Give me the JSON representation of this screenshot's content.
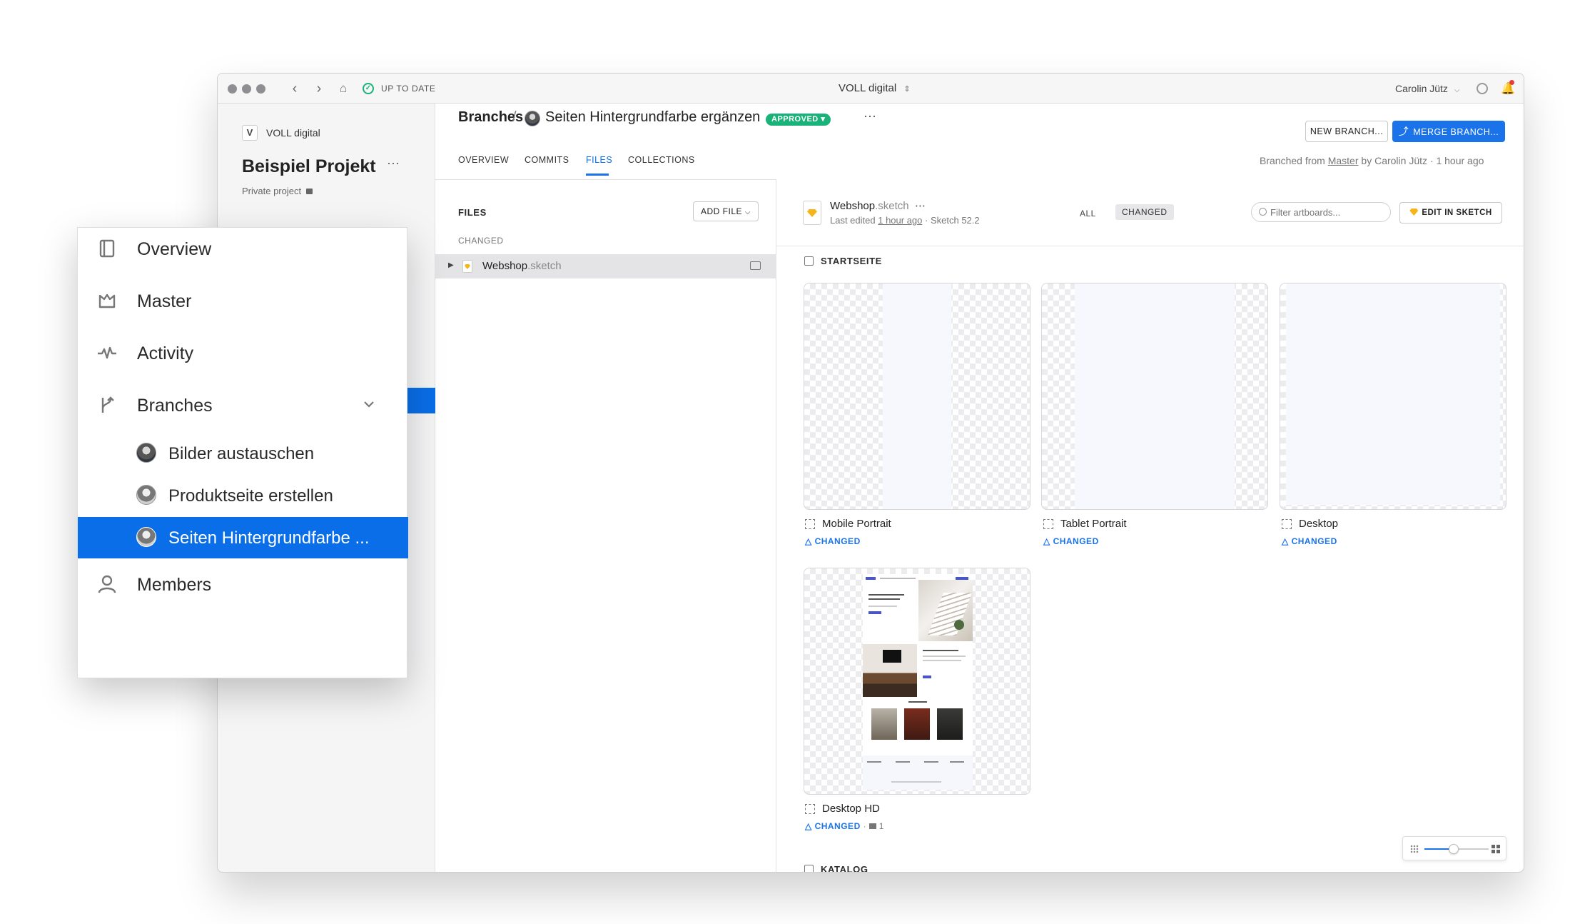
{
  "titlebar": {
    "sync_status": "UP TO DATE",
    "workspace": "VOLL digital",
    "user": "Carolin Jütz"
  },
  "sidebar": {
    "org_name": "VOLL digital",
    "project_title": "Beispiel Projekt",
    "project_visibility": "Private project"
  },
  "header": {
    "breadcrumb_root": "Branches",
    "separator": "/",
    "branch_name": "Seiten Hintergrundfarbe ergänzen",
    "status_badge": "APPROVED",
    "new_branch_label": "NEW BRANCH...",
    "merge_branch_label": "MERGE BRANCH...",
    "branched_from_prefix": "Branched from",
    "branched_from": "Master",
    "branched_by": "by Carolin Jütz · 1 hour ago",
    "tabs": [
      {
        "label": "OVERVIEW",
        "active": false
      },
      {
        "label": "COMMITS",
        "active": false
      },
      {
        "label": "FILES",
        "active": true
      },
      {
        "label": "COLLECTIONS",
        "active": false
      }
    ]
  },
  "files_panel": {
    "title": "FILES",
    "add_file_label": "ADD FILE",
    "section_label": "CHANGED",
    "file_name": "Webshop",
    "file_ext": ".sketch"
  },
  "file_detail": {
    "name": "Webshop",
    "ext": ".sketch",
    "edited_prefix": "Last edited",
    "edited_time": "1 hour ago",
    "edited_suffix": "· Sketch 52.2",
    "filter_all": "ALL",
    "filter_changed": "CHANGED",
    "search_placeholder": "Filter artboards...",
    "edit_in_sketch_label": "EDIT IN SKETCH",
    "page1_title": "STARTSEITE",
    "page2_title": "KATALOG",
    "artboards": [
      {
        "name": "Mobile Portrait",
        "status": "CHANGED"
      },
      {
        "name": "Tablet Portrait",
        "status": "CHANGED"
      },
      {
        "name": "Desktop",
        "status": "CHANGED"
      },
      {
        "name": "Desktop HD",
        "status": "CHANGED",
        "comments": "1"
      }
    ],
    "zoom_level": 0.45
  },
  "popover": {
    "items": [
      {
        "label": "Overview",
        "icon": "notebook-icon"
      },
      {
        "label": "Master",
        "icon": "crown-icon"
      },
      {
        "label": "Activity",
        "icon": "pulse-icon"
      },
      {
        "label": "Branches",
        "icon": "branch-icon"
      }
    ],
    "branches": [
      {
        "label": "Bilder austauschen",
        "selected": false
      },
      {
        "label": "Produktseite erstellen",
        "selected": false
      },
      {
        "label": "Seiten Hintergrundfarbe ...",
        "selected": true
      }
    ],
    "members_label": "Members"
  },
  "colors": {
    "accent": "#1a73e8",
    "approved": "#19b37a",
    "selected_row": "#0a6ee8"
  }
}
